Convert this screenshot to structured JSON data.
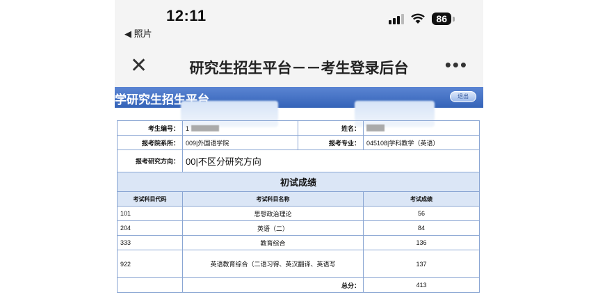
{
  "status_bar": {
    "time": "12:11",
    "back_label": "◀ 照片",
    "battery": "86",
    "icons": [
      "signal-icon",
      "wifi-icon",
      "battery-icon"
    ]
  },
  "nav": {
    "title": "研究生招生平台－－考生登录后台",
    "close_icon": "close-icon",
    "more_icon": "more-icon"
  },
  "banner": {
    "title": "学研究生招生平台",
    "button_label": "退出"
  },
  "info": {
    "candidate_no_label": "考生编号：",
    "candidate_no_value": "1",
    "name_label": "姓名：",
    "department_label": "报考院系所：",
    "department_value": "009|外国语学院",
    "major_label": "报考专业：",
    "major_value": "045108|学科教学（英语）",
    "direction_label": "报考研究方向：",
    "direction_value": "00|不区分研究方向"
  },
  "scores": {
    "section_title": "初试成绩",
    "headers": [
      "考试科目代码",
      "考试科目名称",
      "考试成绩"
    ],
    "rows": [
      {
        "code": "101",
        "name": "思想政治理论",
        "score": "56"
      },
      {
        "code": "204",
        "name": "英语（二）",
        "score": "84"
      },
      {
        "code": "333",
        "name": "教育综合",
        "score": "136"
      },
      {
        "code": "922",
        "name": "英语教育综合（二语习得、英汉翻译、英语写",
        "score": "137"
      }
    ],
    "total_label": "总分：",
    "total_value": "413"
  }
}
